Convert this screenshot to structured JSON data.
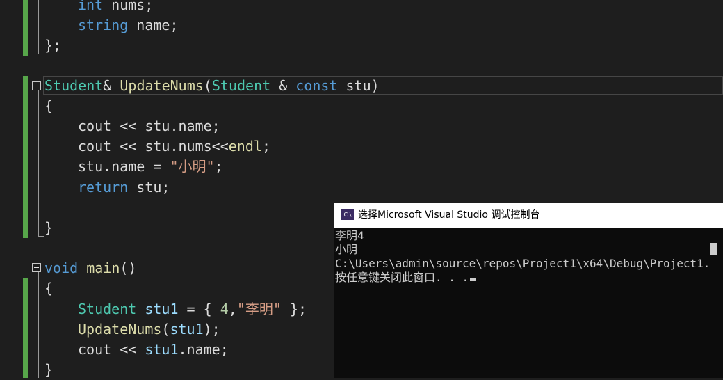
{
  "code": {
    "lines": [
      {
        "tokens": [
          {
            "t": "int",
            "c": "kw"
          },
          {
            "t": " nums;",
            "c": "pl"
          }
        ]
      },
      {
        "tokens": [
          {
            "t": "string",
            "c": "kw"
          },
          {
            "t": " name;",
            "c": "pl"
          }
        ]
      },
      {
        "tokens": [
          {
            "t": "};",
            "c": "pl"
          }
        ]
      },
      {
        "tokens": []
      },
      {
        "tokens": [
          {
            "t": "Student",
            "c": "ty"
          },
          {
            "t": "& ",
            "c": "pl"
          },
          {
            "t": "UpdateNums",
            "c": "fn"
          },
          {
            "t": "(",
            "c": "pl"
          },
          {
            "t": "Student",
            "c": "ty"
          },
          {
            "t": " & ",
            "c": "pl"
          },
          {
            "t": "const",
            "c": "kw"
          },
          {
            "t": " stu)",
            "c": "pl"
          }
        ]
      },
      {
        "tokens": [
          {
            "t": "{",
            "c": "pl"
          }
        ]
      },
      {
        "tokens": [
          {
            "t": "cout",
            "c": "pl"
          },
          {
            "t": " << ",
            "c": "pl"
          },
          {
            "t": "stu",
            "c": "pl"
          },
          {
            "t": ".name;",
            "c": "pl"
          }
        ]
      },
      {
        "tokens": [
          {
            "t": "cout",
            "c": "pl"
          },
          {
            "t": " << ",
            "c": "pl"
          },
          {
            "t": "stu",
            "c": "pl"
          },
          {
            "t": ".nums<<",
            "c": "pl"
          },
          {
            "t": "endl",
            "c": "fn"
          },
          {
            "t": ";",
            "c": "pl"
          }
        ]
      },
      {
        "tokens": [
          {
            "t": "stu",
            "c": "pl"
          },
          {
            "t": ".name = ",
            "c": "pl"
          },
          {
            "t": "\"小明\"",
            "c": "st"
          },
          {
            "t": ";",
            "c": "pl"
          }
        ]
      },
      {
        "tokens": [
          {
            "t": "return",
            "c": "kw"
          },
          {
            "t": " stu;",
            "c": "pl"
          }
        ]
      },
      {
        "tokens": []
      },
      {
        "tokens": [
          {
            "t": "}",
            "c": "pl"
          }
        ]
      },
      {
        "tokens": []
      },
      {
        "tokens": [
          {
            "t": "void",
            "c": "kw"
          },
          {
            "t": " ",
            "c": "pl"
          },
          {
            "t": "main",
            "c": "fn"
          },
          {
            "t": "()",
            "c": "pl"
          }
        ]
      },
      {
        "tokens": [
          {
            "t": "{",
            "c": "pl"
          }
        ]
      },
      {
        "tokens": [
          {
            "t": "Student",
            "c": "ty"
          },
          {
            "t": " ",
            "c": "pl"
          },
          {
            "t": "stu1",
            "c": "id"
          },
          {
            "t": " = { ",
            "c": "pl"
          },
          {
            "t": "4",
            "c": "nu"
          },
          {
            "t": ",",
            "c": "pl"
          },
          {
            "t": "\"李明\"",
            "c": "st"
          },
          {
            "t": " };",
            "c": "pl"
          }
        ]
      },
      {
        "tokens": [
          {
            "t": "UpdateNums",
            "c": "fn"
          },
          {
            "t": "(",
            "c": "pl"
          },
          {
            "t": "stu1",
            "c": "id"
          },
          {
            "t": ");",
            "c": "pl"
          }
        ]
      },
      {
        "tokens": [
          {
            "t": "cout",
            "c": "pl"
          },
          {
            "t": " << ",
            "c": "pl"
          },
          {
            "t": "stu1",
            "c": "id"
          },
          {
            "t": ".name;",
            "c": "pl"
          }
        ]
      },
      {
        "tokens": [
          {
            "t": "}",
            "c": "pl"
          }
        ]
      }
    ]
  },
  "console": {
    "title": "选择Microsoft Visual Studio 调试控制台",
    "icon": "console-app-icon",
    "icon_text": "C:\\",
    "lines": [
      "李明4",
      "小明",
      "C:\\Users\\admin\\source\\repos\\Project1\\x64\\Debug\\Project1.",
      "按任意键关闭此窗口. . ."
    ]
  },
  "colors": {
    "background": "#1e1e1e",
    "keyword": "#569cd6",
    "type": "#4ec9b0",
    "function": "#dcdcaa",
    "string": "#d69d85",
    "change_bar": "#57a64a",
    "console_bg": "#0c0c0c"
  }
}
